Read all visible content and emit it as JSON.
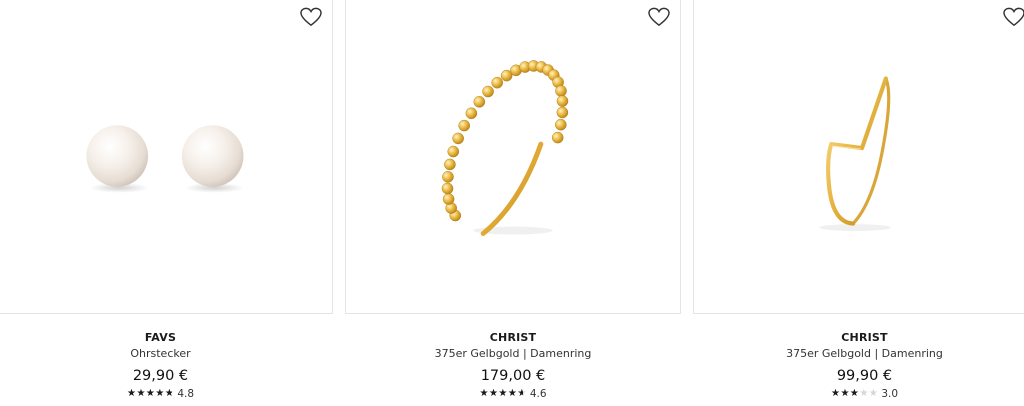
{
  "products": [
    {
      "brand": "FAVS",
      "name": "Ohrstecker",
      "price": "29,90 €",
      "rating": 4.8,
      "rating_label": "4.8",
      "wishlist_icon": "heart-outline-icon",
      "image_icon": "pearl-earrings"
    },
    {
      "brand": "CHRIST",
      "name": "375er Gelbgold | Damenring",
      "price": "179,00 €",
      "rating": 4.6,
      "rating_label": "4.6",
      "wishlist_icon": "heart-outline-icon",
      "image_icon": "beaded-gold-ring"
    },
    {
      "brand": "CHRIST",
      "name": "375er Gelbgold | Damenring",
      "price": "99,90 €",
      "rating": 3.0,
      "rating_label": "3.0",
      "wishlist_icon": "heart-outline-icon",
      "image_icon": "chevron-gold-ring"
    }
  ],
  "colors": {
    "gold": "#e7b648",
    "gold_dark": "#b98414",
    "star": "#1a1a1a",
    "star_empty": "#d6d6d6",
    "border": "#e4e4e4"
  }
}
